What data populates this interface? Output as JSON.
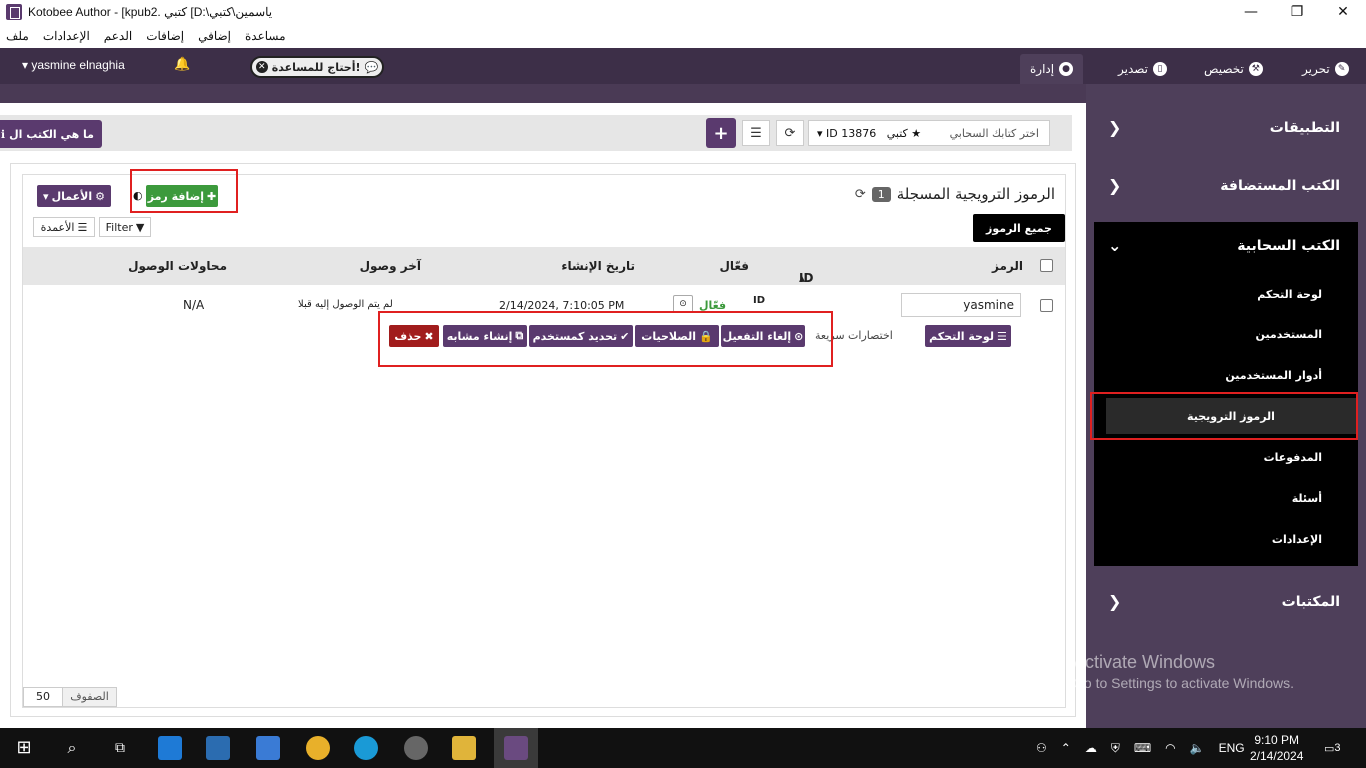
{
  "window": {
    "title": "Kotobee Author - [kpub2. كتبي [D:\\ياسمين\\كتبي",
    "controls": {
      "minimize": "—",
      "maximize": "❐",
      "close": "✕"
    }
  },
  "menu": [
    "ملف",
    "الإعدادات",
    "الدعم",
    "إضافات",
    "إضافي",
    "مساعدة"
  ],
  "topbar": {
    "user": "yasmine elnaghia",
    "help": "أحتاج للمساعدة!",
    "tabs": {
      "edit": "تحرير",
      "customize": "تخصيص",
      "export": "تصدير",
      "manage": "إدارة"
    }
  },
  "sidebar": {
    "apps": "التطبيقات",
    "hosted": "الكتب المستضافة",
    "cloud": "الكتب السحابية",
    "cloud_items": [
      "لوحة التحكم",
      "المستخدمين",
      "أدوار المستخدمين",
      "الرموز الترويجية",
      "المدفوعات",
      "أسئلة",
      "الإعدادات"
    ],
    "libraries": "المكتبات"
  },
  "toolbar": {
    "what_btn": "ما هي الكتب ال",
    "select_placeholder": "اختر كتابك السحابي",
    "selected_book": "كتبي",
    "book_id": "ID 13876"
  },
  "panel": {
    "title": "الرموز الترويجية المسجلة",
    "count": "1",
    "all_codes": "جميع الرموز",
    "add_code": "إضافة رمز",
    "actions": "الأعمال",
    "filter": "Filter",
    "columns": "الأعمدة"
  },
  "table": {
    "headers": {
      "code": "الرمز",
      "id": "ID",
      "active": "فعّال",
      "created": "تاريخ الإنشاء",
      "last_access": "آخر وصول",
      "attempts": "محاولات الوصول"
    },
    "row": {
      "code": "yasmine",
      "id": "ID",
      "active": "فعّال",
      "created": "2/14/2024, 7:10:05 PM",
      "last_access": "لم يتم الوصول إليه قبلا",
      "attempts": "N/A"
    },
    "shortcuts_label": "اختصارات سريعة",
    "quick": {
      "dashboard": "لوحة التحكم",
      "deactivate": "إلغاء التفعيل",
      "permissions": "الصلاحيات",
      "select_user": "تحديد كمستخدم",
      "create_similar": "إنشاء مشابه",
      "delete": "حذف"
    }
  },
  "pager": {
    "rows_label": "الصفوف",
    "rows_value": "50"
  },
  "watermark": {
    "line1": "Activate Windows",
    "line2": "Go to Settings to activate Windows."
  },
  "taskbar": {
    "lang": "ENG",
    "time": "9:10 PM",
    "date": "2/14/2024",
    "notifications": "3"
  }
}
